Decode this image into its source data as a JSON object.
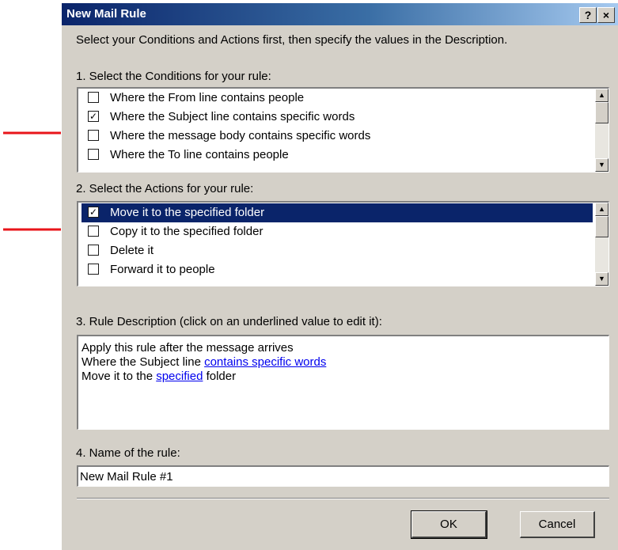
{
  "window": {
    "title": "New Mail Rule",
    "help_glyph": "?",
    "close_glyph": "×"
  },
  "instructions": "Select your Conditions and Actions first, then specify the values in the Description.",
  "conditions": {
    "heading": "1. Select the Conditions for your rule:",
    "items": [
      {
        "label": "Where the From line contains people",
        "checked": false
      },
      {
        "label": "Where the Subject line contains specific words",
        "checked": true
      },
      {
        "label": "Where the message body contains specific words",
        "checked": false
      },
      {
        "label": "Where the To line contains people",
        "checked": false
      }
    ]
  },
  "actions": {
    "heading": "2. Select the Actions for your rule:",
    "items": [
      {
        "label": "Move it to the specified folder",
        "checked": true,
        "selected": true
      },
      {
        "label": "Copy it to the specified folder",
        "checked": false
      },
      {
        "label": "Delete it",
        "checked": false
      },
      {
        "label": "Forward it to people",
        "checked": false
      }
    ]
  },
  "description": {
    "heading": "3. Rule Description (click on an underlined value to edit it):",
    "line1": "Apply this rule after the message arrives",
    "line2_prefix": "Where the Subject line ",
    "line2_link": "contains specific words",
    "line3_prefix": "Move it to the ",
    "line3_link": "specified",
    "line3_suffix": " folder"
  },
  "rule_name": {
    "heading": "4. Name of the rule:",
    "value": "New Mail Rule #1"
  },
  "buttons": {
    "ok": "OK",
    "cancel": "Cancel"
  },
  "scroll_glyphs": {
    "up": "▲",
    "down": "▼"
  },
  "check_glyph": "✓",
  "colors": {
    "title_gradient_start": "#0a246a",
    "selection": "#0a246a",
    "annotation_arrow": "#e8141a",
    "dialog_face": "#d4d0c8",
    "link": "#0000ee"
  }
}
